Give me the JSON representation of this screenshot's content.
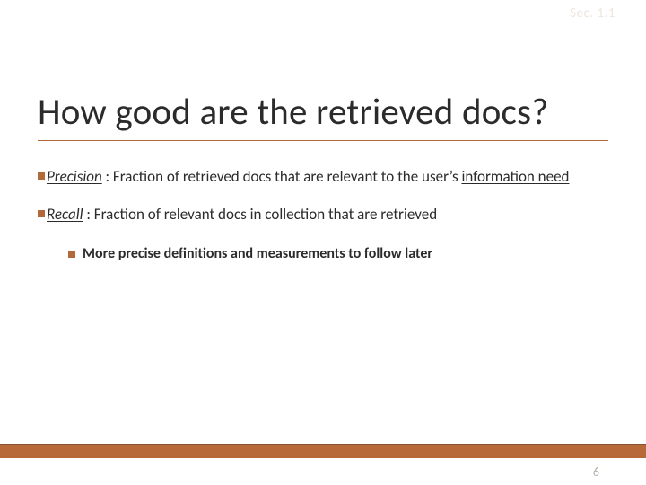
{
  "sectionLabel": "Sec. 1.1",
  "title": "How good are the retrieved docs?",
  "bullets": [
    {
      "term": "Precision",
      "rest_a": " : Fraction of retrieved docs that are relevant to the user’s ",
      "underlined_tail": "information need",
      "rest_b": ""
    },
    {
      "term": "Recall",
      "rest_a": " : Fraction of relevant docs in collection that are retrieved",
      "underlined_tail": "",
      "rest_b": ""
    }
  ],
  "subBullet": "More precise definitions and measurements to follow later",
  "pageNumber": "6",
  "accentColor": "#b36a3a"
}
